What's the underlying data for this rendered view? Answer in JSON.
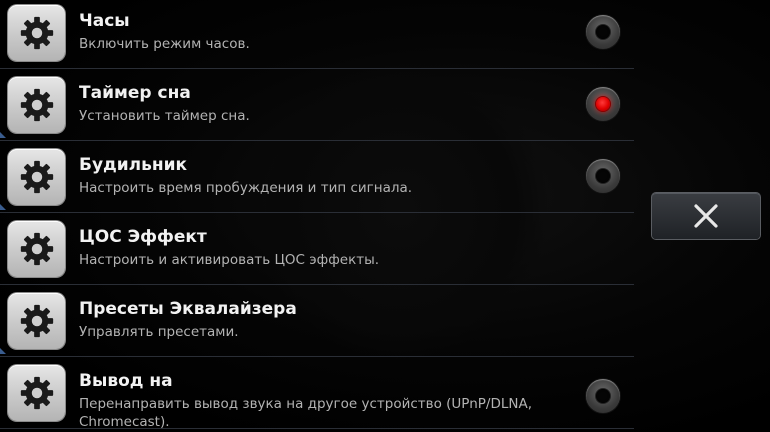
{
  "settings": {
    "items": [
      {
        "title": "Часы",
        "subtitle": "Включить режим часов.",
        "has_radio": true,
        "selected": false,
        "icon": "gear-icon"
      },
      {
        "title": "Таймер сна",
        "subtitle": "Установить таймер сна.",
        "has_radio": true,
        "selected": true,
        "icon": "gear-icon"
      },
      {
        "title": "Будильник",
        "subtitle": "Настроить время пробуждения и тип сигнала.",
        "has_radio": true,
        "selected": false,
        "icon": "gear-icon"
      },
      {
        "title": "ЦОС Эффект",
        "subtitle": "Настроить и активировать ЦОС эффекты.",
        "has_radio": false,
        "selected": false,
        "icon": "gear-icon"
      },
      {
        "title": "Пресеты Эквалайзера",
        "subtitle": "Управлять пресетами.",
        "has_radio": false,
        "selected": false,
        "icon": "gear-icon"
      },
      {
        "title": "Вывод на",
        "subtitle": "Перенаправить вывод звука на другое устройство (UPnP/DLNA, Chromecast).",
        "has_radio": true,
        "selected": false,
        "icon": "gear-icon"
      }
    ]
  },
  "close_button": {
    "icon": "close-icon"
  },
  "colors": {
    "background": "#000000",
    "title": "#f2f2f2",
    "subtitle": "#b3b3b3",
    "radio_on": "#e00000",
    "divider": "#2a2e36"
  }
}
